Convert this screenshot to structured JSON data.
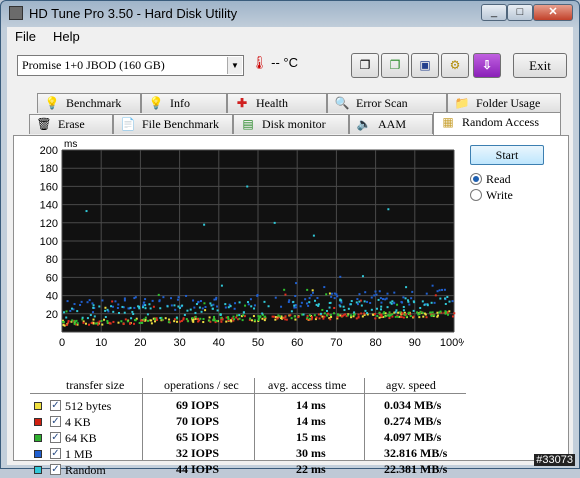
{
  "window": {
    "title": "HD Tune Pro 3.50 - Hard Disk Utility",
    "minimize": "_",
    "maximize": "□",
    "close": "✕"
  },
  "menu": {
    "file": "File",
    "help": "Help"
  },
  "toolbar": {
    "drive": "Promise 1+0 JBOD (160 GB)",
    "temperature": "-- °C",
    "exit": "Exit",
    "buttons": [
      "copy-text-icon",
      "copy-screenshot-icon",
      "save-icon",
      "options-icon",
      "download-icon"
    ]
  },
  "tabs_row1": [
    "Benchmark",
    "Info",
    "Health",
    "Error Scan",
    "Folder Usage"
  ],
  "tabs_row2": [
    "Erase",
    "File Benchmark",
    "Disk monitor",
    "AAM",
    "Random Access"
  ],
  "controls": {
    "start": "Start",
    "read": "Read",
    "write": "Write",
    "selected": "Read"
  },
  "chart_data": {
    "type": "scatter",
    "ylabel": "ms",
    "ylim": [
      0,
      200
    ],
    "xlim": [
      0,
      100
    ],
    "y_ticks": [
      "200",
      "180",
      "160",
      "140",
      "120",
      "100",
      "80",
      "60",
      "40",
      "20"
    ],
    "x_ticks": [
      "0",
      "10",
      "20",
      "30",
      "40",
      "50",
      "60",
      "70",
      "80",
      "90",
      "100%"
    ],
    "grid": true,
    "series": [
      {
        "name": "512 bytes",
        "color": "#f0e040"
      },
      {
        "name": "4 KB",
        "color": "#e03020"
      },
      {
        "name": "64 KB",
        "color": "#30c030"
      },
      {
        "name": "1 MB",
        "color": "#2060d0"
      },
      {
        "name": "Random",
        "color": "#30c8d8"
      }
    ]
  },
  "results": {
    "headers": [
      "transfer size",
      "operations / sec",
      "avg. access time",
      "agv. speed"
    ],
    "rows": [
      {
        "label": "512 bytes",
        "color": "#f0e040",
        "ops": "69 IOPS",
        "access": "14 ms",
        "speed": "0.034 MB/s"
      },
      {
        "label": "4 KB",
        "color": "#d02010",
        "ops": "70 IOPS",
        "access": "14 ms",
        "speed": "0.274 MB/s"
      },
      {
        "label": "64 KB",
        "color": "#30b030",
        "ops": "65 IOPS",
        "access": "15 ms",
        "speed": "4.097 MB/s"
      },
      {
        "label": "1 MB",
        "color": "#2060d0",
        "ops": "32 IOPS",
        "access": "30 ms",
        "speed": "32.816 MB/s"
      },
      {
        "label": "Random",
        "color": "#30c8d8",
        "ops": "44 IOPS",
        "access": "22 ms",
        "speed": "22.381 MB/s"
      }
    ]
  },
  "watermark": "#33073"
}
